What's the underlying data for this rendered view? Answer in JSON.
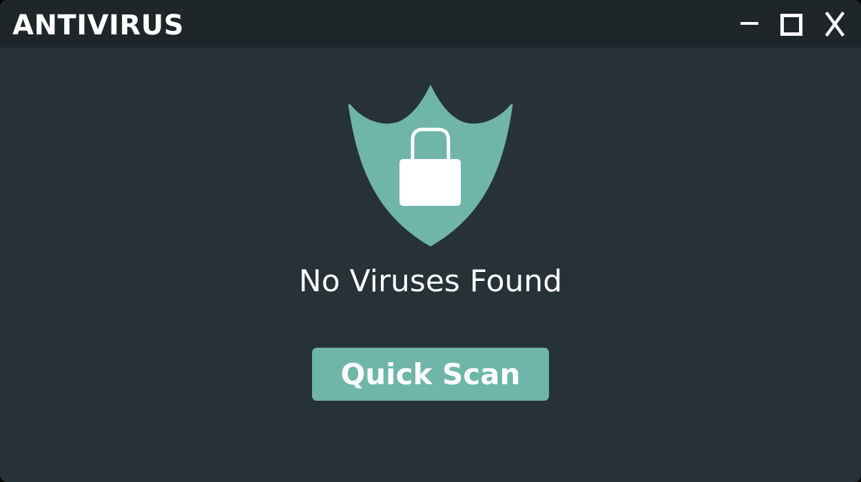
{
  "window": {
    "title": "ANTIVIRUS",
    "controls": {
      "minimize_icon": "minimize-icon",
      "maximize_icon": "maximize-icon",
      "close_icon": "close-icon"
    }
  },
  "main": {
    "status_icon": "shield-lock-icon",
    "status_text": "No Viruses Found",
    "scan_button_label": "Quick Scan"
  },
  "colors": {
    "window_background": "#273238",
    "titlebar_background": "#1f2629",
    "accent": "#6fb5aa",
    "text": "#ffffff"
  }
}
